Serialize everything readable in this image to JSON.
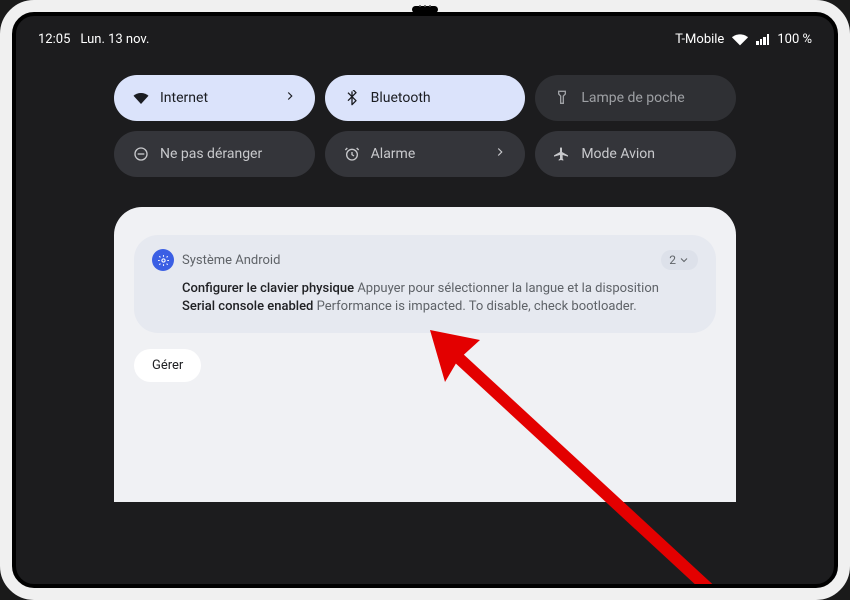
{
  "status_bar": {
    "time": "12:05",
    "date": "Lun. 13 nov.",
    "carrier": "T-Mobile",
    "battery": "100 %"
  },
  "quick_settings": {
    "tiles": [
      {
        "icon": "wifi-icon",
        "label": "Internet",
        "state": "active",
        "has_chevron": true
      },
      {
        "icon": "bluetooth-icon",
        "label": "Bluetooth",
        "state": "active",
        "has_chevron": false
      },
      {
        "icon": "flashlight-icon",
        "label": "Lampe de poche",
        "state": "dim",
        "has_chevron": false
      },
      {
        "icon": "dnd-icon",
        "label": "Ne pas déranger",
        "state": "off",
        "has_chevron": false
      },
      {
        "icon": "alarm-icon",
        "label": "Alarme",
        "state": "off",
        "has_chevron": true
      },
      {
        "icon": "airplane-icon",
        "label": "Mode Avion",
        "state": "off",
        "has_chevron": false
      }
    ]
  },
  "notification": {
    "app_name": "Système Android",
    "group_count": "2",
    "lines": [
      {
        "title": "Configurer le clavier physique",
        "body": "Appuyer pour sélectionner la langue et la disposition"
      },
      {
        "title": "Serial console enabled",
        "body": "Performance is impacted. To disable, check bootloader."
      }
    ],
    "manage_label": "Gérer"
  },
  "annotation": {
    "arrow_color": "#e30000"
  }
}
